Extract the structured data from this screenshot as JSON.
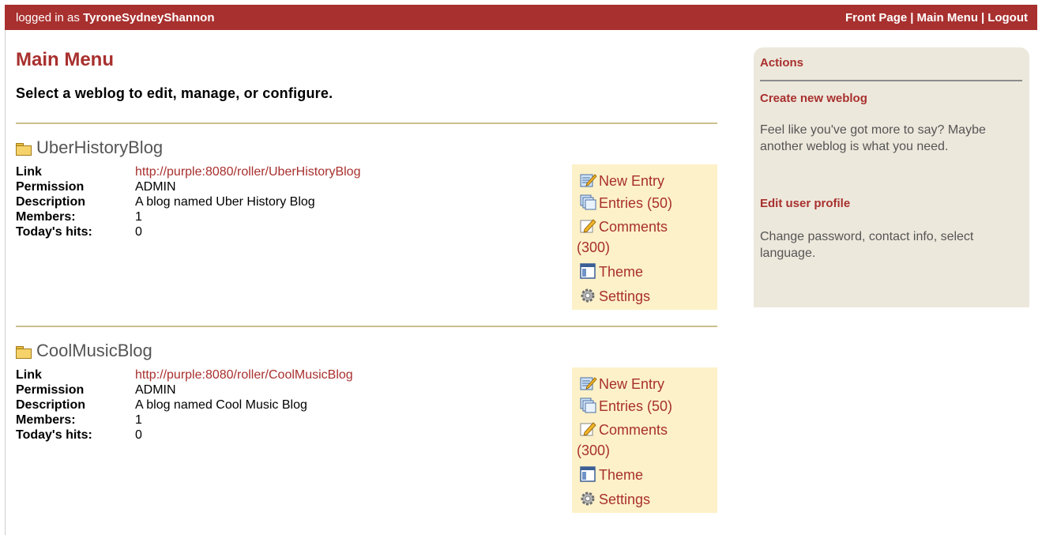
{
  "topbar": {
    "logged_prefix": "logged in as",
    "username": "TyroneSydneyShannon",
    "nav": {
      "front_page": "Front Page",
      "main_menu": "Main Menu",
      "logout": "Logout",
      "separator": "|"
    }
  },
  "page": {
    "title": "Main Menu",
    "subtitle": "Select a weblog to edit, manage, or configure."
  },
  "labels": {
    "link": "Link",
    "permission": "Permission",
    "description": "Description",
    "members": "Members:",
    "hits": "Today's hits:"
  },
  "blogs": [
    {
      "name": "UberHistoryBlog",
      "link": "http://purple:8080/roller/UberHistoryBlog",
      "permission": "ADMIN",
      "description": "A blog named Uber History Blog",
      "members": "1",
      "hits": "0",
      "actions": {
        "new_entry": "New Entry",
        "entries": "Entries (50)",
        "comments": "Comments",
        "comments_count": "(300)",
        "theme": "Theme",
        "settings": "Settings"
      }
    },
    {
      "name": "CoolMusicBlog",
      "link": "http://purple:8080/roller/CoolMusicBlog",
      "permission": "ADMIN",
      "description": "A blog named Cool Music Blog",
      "members": "1",
      "hits": "0",
      "actions": {
        "new_entry": "New Entry",
        "entries": "Entries (50)",
        "comments": "Comments",
        "comments_count": "(300)",
        "theme": "Theme",
        "settings": "Settings"
      }
    }
  ],
  "sidebar": {
    "heading": "Actions",
    "create_link": "Create new weblog",
    "create_text": "Feel like you've got more to say? Maybe another weblog is what you need.",
    "profile_link": "Edit user profile",
    "profile_text": "Change password, contact info, select language."
  },
  "colors": {
    "brand": "#a8302e",
    "sidebar_bg": "#ede8dc",
    "actions_bg": "#fdf1c9",
    "divider": "#cbbf8c"
  }
}
